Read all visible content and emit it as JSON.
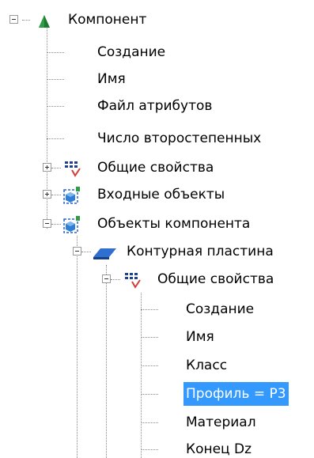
{
  "tree": {
    "root": {
      "label": "Компонент",
      "icon": "green-cone-icon"
    },
    "nodes": [
      {
        "label": "Создание"
      },
      {
        "label": "Имя"
      },
      {
        "label": "Файл атрибутов"
      },
      {
        "label": "Число второстепенных"
      },
      {
        "label": "Общие свойства",
        "icon": "properties-icon",
        "state": "collapsed"
      },
      {
        "label": "Входные объекты",
        "icon": "objects-icon",
        "state": "collapsed"
      },
      {
        "label": "Объекты компонента",
        "icon": "objects-icon",
        "state": "expanded"
      },
      {
        "label": "Контурная пластина",
        "icon": "plate-icon",
        "state": "expanded"
      },
      {
        "label": "Общие свойства",
        "icon": "properties-icon",
        "state": "expanded"
      },
      {
        "label": "Создание"
      },
      {
        "label": "Имя"
      },
      {
        "label": "Класс"
      },
      {
        "label": "Профиль = P3",
        "selected": true
      },
      {
        "label": "Материал"
      },
      {
        "label": "Конец Dz"
      }
    ]
  },
  "colors": {
    "selection": "#3399ff",
    "root_icon": "#1e7a32"
  }
}
